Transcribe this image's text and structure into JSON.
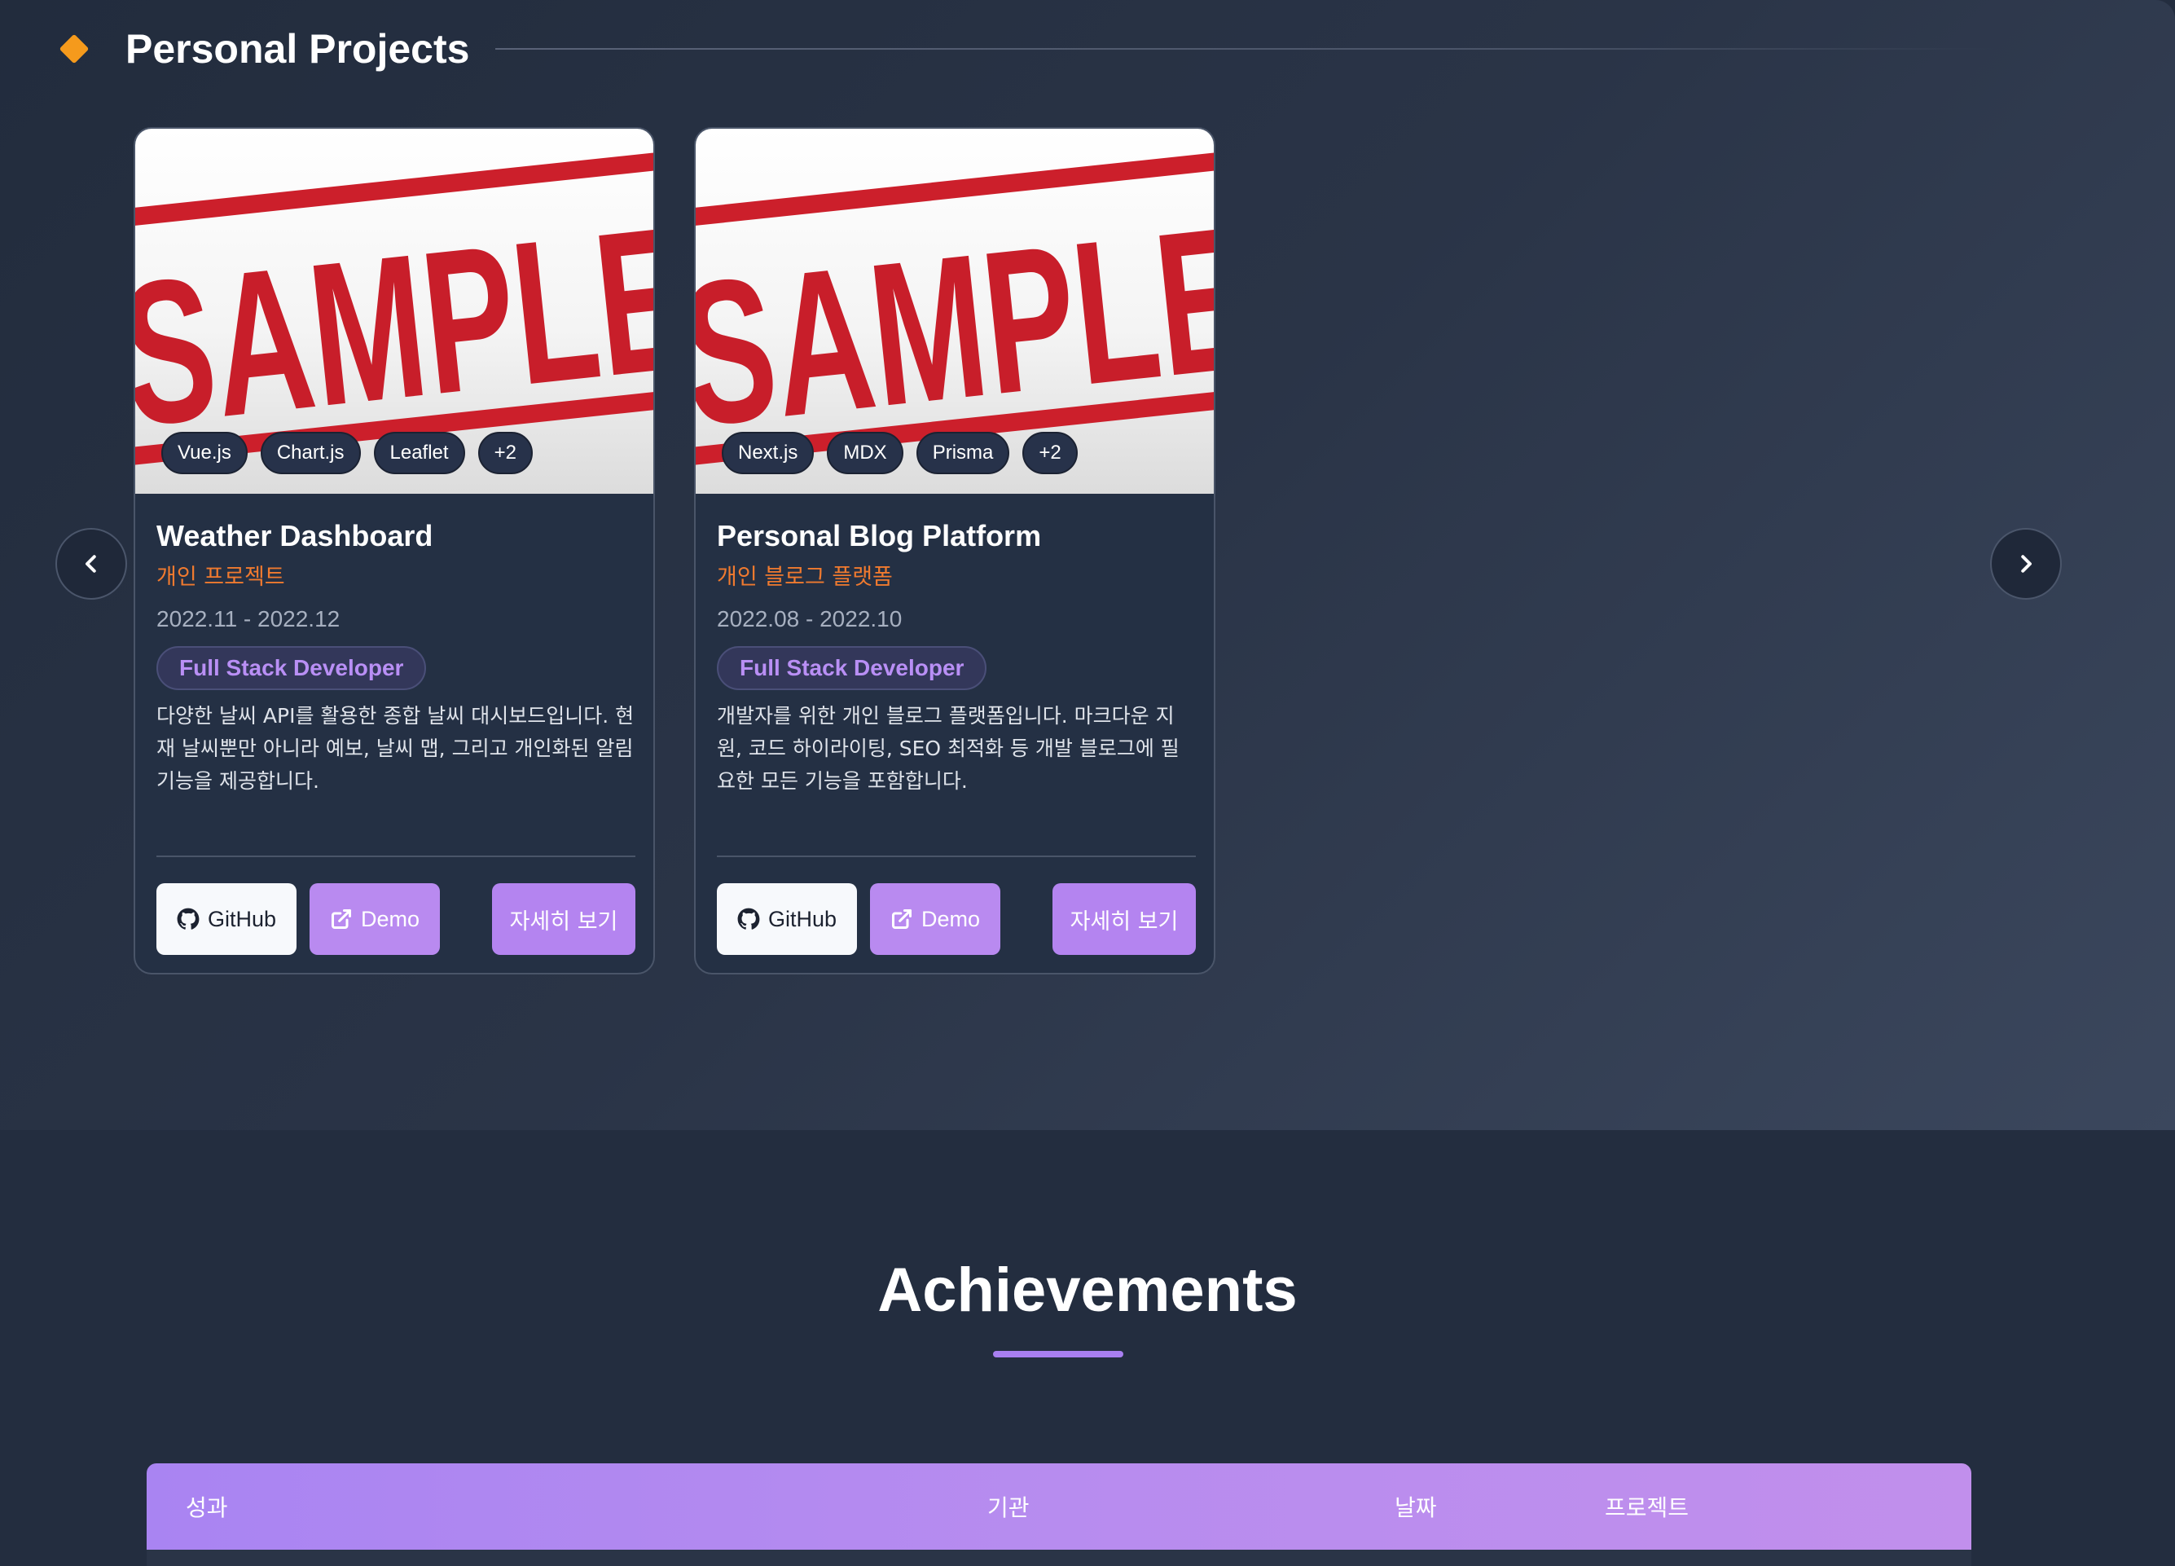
{
  "projects_section": {
    "title": "Personal Projects",
    "prev_icon": "chevron-left-icon",
    "next_icon": "chevron-right-icon",
    "cards": [
      {
        "image_text": "SAMPLE",
        "tags": [
          "Vue.js",
          "Chart.js",
          "Leaflet",
          "+2"
        ],
        "title": "Weather Dashboard",
        "subtitle": "개인 프로젝트",
        "date": "2022.11 - 2022.12",
        "role": "Full Stack Developer",
        "description": "다양한 날씨 API를 활용한 종합 날씨 대시보드입니다. 현재 날씨뿐만 아니라 예보, 날씨 맵, 그리고 개인화된 알림 기능을 제공합니다.",
        "github_label": "GitHub",
        "demo_label": "Demo",
        "detail_label": "자세히 보기"
      },
      {
        "image_text": "SAMPLE",
        "tags": [
          "Next.js",
          "MDX",
          "Prisma",
          "+2"
        ],
        "title": "Personal Blog Platform",
        "subtitle": "개인 블로그 플랫폼",
        "date": "2022.08 - 2022.10",
        "role": "Full Stack Developer",
        "description": "개발자를 위한 개인 블로그 플랫폼입니다. 마크다운 지원, 코드 하이라이팅, SEO 최적화 등 개발 블로그에 필요한 모든 기능을 포함합니다.",
        "github_label": "GitHub",
        "demo_label": "Demo",
        "detail_label": "자세히 보기"
      }
    ]
  },
  "achievements": {
    "title": "Achievements",
    "columns": [
      "성과",
      "기관",
      "날짜",
      "프로젝트"
    ]
  },
  "colors": {
    "accent_purple": "#b484f0",
    "accent_orange": "#f07a2f",
    "diamond": "#f59a1c",
    "background": "#232d3f"
  }
}
